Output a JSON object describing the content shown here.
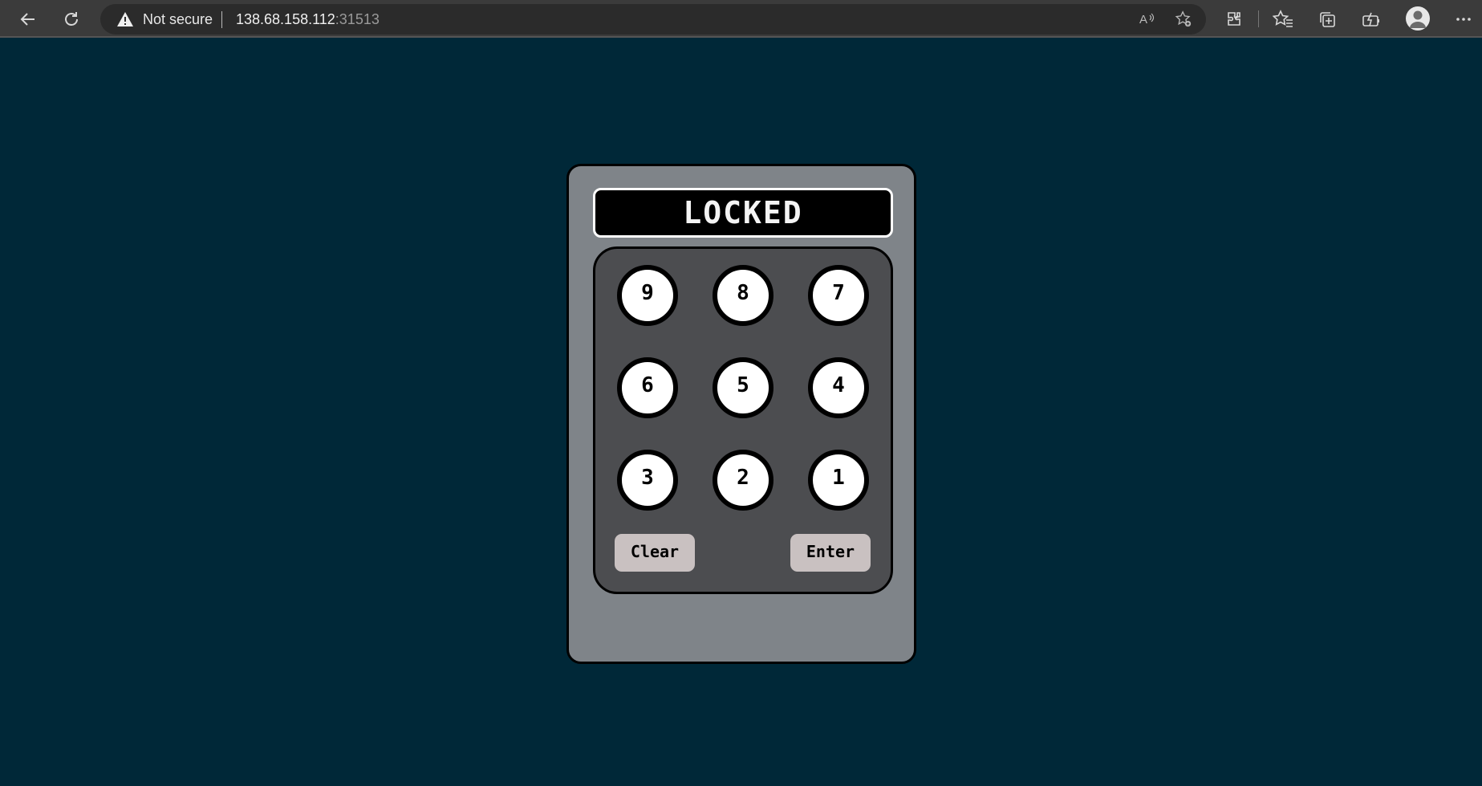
{
  "browser": {
    "security_label": "Not secure",
    "url_host": "138.68.158.112",
    "url_port": ":31513",
    "icons": [
      "back-icon",
      "refresh-icon",
      "warning-icon",
      "read-aloud-icon",
      "add-favorite-icon",
      "extensions-icon",
      "favorites-icon",
      "collections-icon",
      "performance-icon",
      "profile-icon",
      "more-icon"
    ]
  },
  "lock": {
    "status": "LOCKED",
    "keys": [
      "9",
      "8",
      "7",
      "6",
      "5",
      "4",
      "3",
      "2",
      "1"
    ],
    "clear_label": "Clear",
    "enter_label": "Enter"
  },
  "colors": {
    "page_background": "#002838",
    "device_body": "#7f8489",
    "keypad_panel": "#4c4d50",
    "key_face": "#ffffff",
    "action_button": "#c9c1c1",
    "display_background": "#000000"
  }
}
